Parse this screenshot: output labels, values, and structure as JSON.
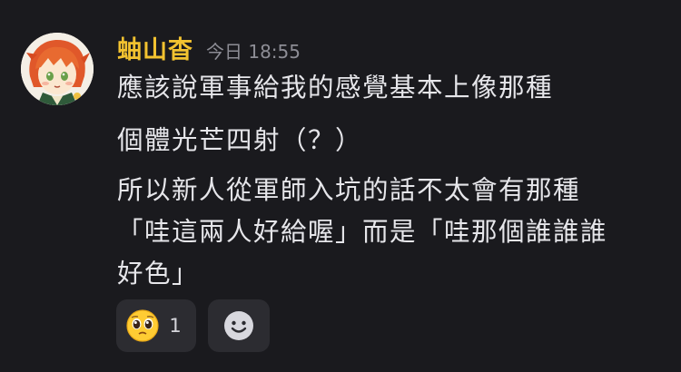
{
  "message": {
    "author": "蚰山杳",
    "timestamp": "今日 18:55",
    "lines": [
      "應該說軍事給我的感覺基本上像那種",
      "個體光芒四射（？）",
      "所以新人從軍師入坑的話不太會有那種",
      "「哇這兩人好給喔」而是「哇那個誰誰誰",
      "好色」"
    ]
  },
  "reactions": [
    {
      "icon": "pleading-face-emoji",
      "count": "1"
    },
    {
      "icon": "add-reaction-smile-icon"
    }
  ],
  "colors": {
    "background": "#1a1a1e",
    "author": "#f2c230",
    "text": "#e6e6ea",
    "muted": "#8d8d95",
    "chip": "#2c2c31"
  }
}
